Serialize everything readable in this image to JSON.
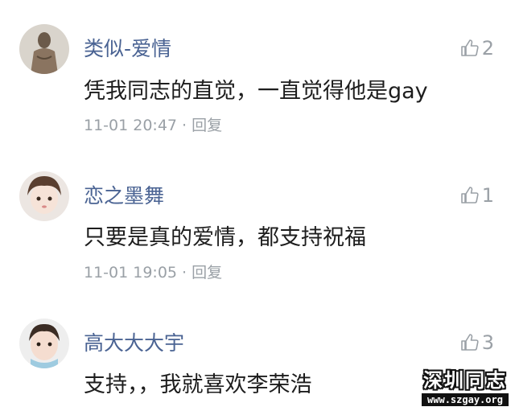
{
  "comments": [
    {
      "username": "类似-爱情",
      "likes": "2",
      "text": "凭我同志的直觉，一直觉得他是gay",
      "time": "11-01 20:47",
      "separator": "·",
      "reply": "回复"
    },
    {
      "username": "恋之墨舞",
      "likes": "1",
      "text": "只要是真的爱情，都支持祝福",
      "time": "11-01 19:05",
      "separator": "·",
      "reply": "回复"
    },
    {
      "username": "高大大大宇",
      "likes": "3",
      "text": "支持，，我就喜欢李荣浩",
      "time": "",
      "separator": "",
      "reply": ""
    }
  ],
  "watermark": {
    "title": "深圳同志",
    "url": "www.szgay.org"
  },
  "colors": {
    "username": "#4a6393",
    "meta": "#9aa0a6",
    "text": "#1d1d1d"
  }
}
